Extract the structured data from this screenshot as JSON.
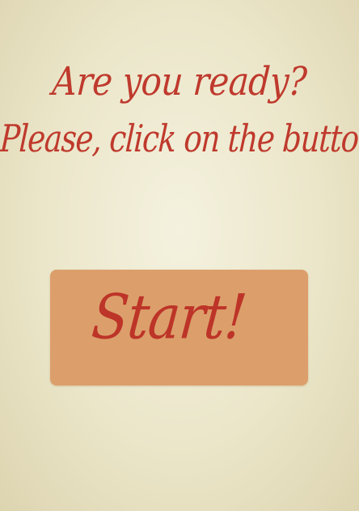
{
  "prompt": {
    "line1": "Are you ready?",
    "line2": "Please, click on the button..."
  },
  "start_button": {
    "label": "Start!"
  },
  "colors": {
    "text": "#bf3a2d",
    "button_bg": "#dc9f6b",
    "background": "#ebe6c9"
  }
}
